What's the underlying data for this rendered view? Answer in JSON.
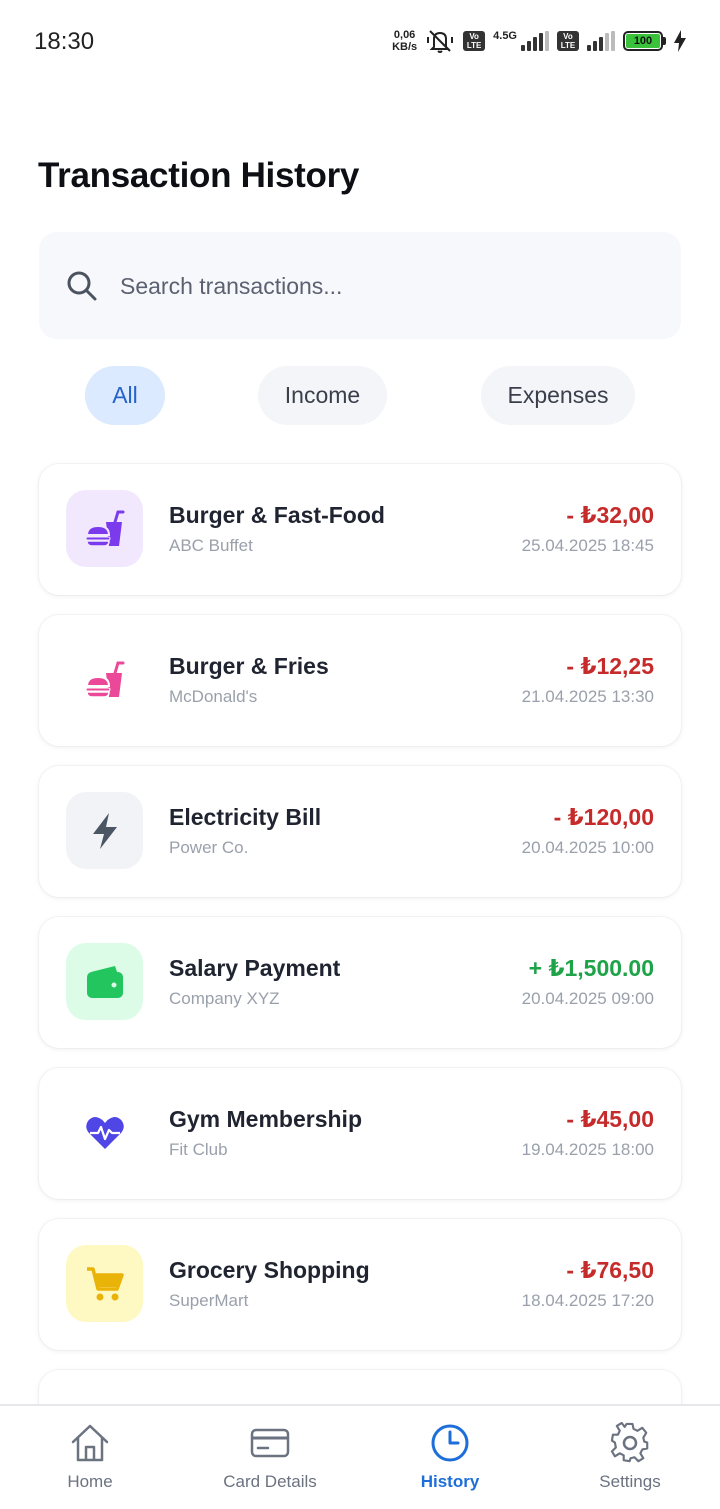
{
  "status_bar": {
    "time": "18:30",
    "net_speed_value": "0,06",
    "net_speed_unit": "KB/s",
    "volte_label_1": "Vo\nLTE",
    "volte_label_2": "Vo\nLTE",
    "network_type": "4.5G",
    "battery_level": "100"
  },
  "header": {
    "title": "Transaction History"
  },
  "search": {
    "placeholder": "Search transactions..."
  },
  "filters": [
    {
      "label": "All",
      "active": true
    },
    {
      "label": "Income",
      "active": false
    },
    {
      "label": "Expenses",
      "active": false
    }
  ],
  "transactions": [
    {
      "title": "Burger & Fast-Food",
      "merchant": "ABC Buffet",
      "amount": "- ₺32,00",
      "date": "25.04.2025 18:45",
      "icon": "fast-food-icon",
      "icon_color": "#7c3aed",
      "icon_bg": "#f1e8fd"
    },
    {
      "title": "Burger & Fries",
      "merchant": "McDonald's",
      "amount": "- ₺12,25",
      "date": "21.04.2025 13:30",
      "icon": "fast-food-icon",
      "icon_color": "#ec4899",
      "icon_bg": "#ffffff"
    },
    {
      "title": "Electricity Bill",
      "merchant": "Power Co.",
      "amount": "- ₺120,00",
      "date": "20.04.2025 10:00",
      "icon": "lightning-icon",
      "icon_color": "#4b5563",
      "icon_bg": "#f1f3f6"
    },
    {
      "title": "Salary Payment",
      "merchant": "Company XYZ",
      "amount": "+ ₺1,500.00",
      "date": "20.04.2025 09:00",
      "icon": "wallet-icon",
      "icon_color": "#22c55e",
      "icon_bg": "#dcfce7"
    },
    {
      "title": "Gym Membership",
      "merchant": "Fit Club",
      "amount": "- ₺45,00",
      "date": "19.04.2025 18:00",
      "icon": "heartbeat-icon",
      "icon_color": "#4f46e5",
      "icon_bg": "#ffffff"
    },
    {
      "title": "Grocery Shopping",
      "merchant": "SuperMart",
      "amount": "- ₺76,50",
      "date": "18.04.2025 17:20",
      "icon": "cart-icon",
      "icon_color": "#eab308",
      "icon_bg": "#fef9c3"
    }
  ],
  "bottom_nav": [
    {
      "label": "Home",
      "icon": "home-icon",
      "active": false
    },
    {
      "label": "Card Details",
      "icon": "credit-card-icon",
      "active": false
    },
    {
      "label": "History",
      "icon": "clock-icon",
      "active": true
    },
    {
      "label": "Settings",
      "icon": "gear-icon",
      "active": false
    }
  ],
  "colors": {
    "accent": "#1d6ed8",
    "negative": "#c62b2b",
    "positive": "#1fa348"
  }
}
